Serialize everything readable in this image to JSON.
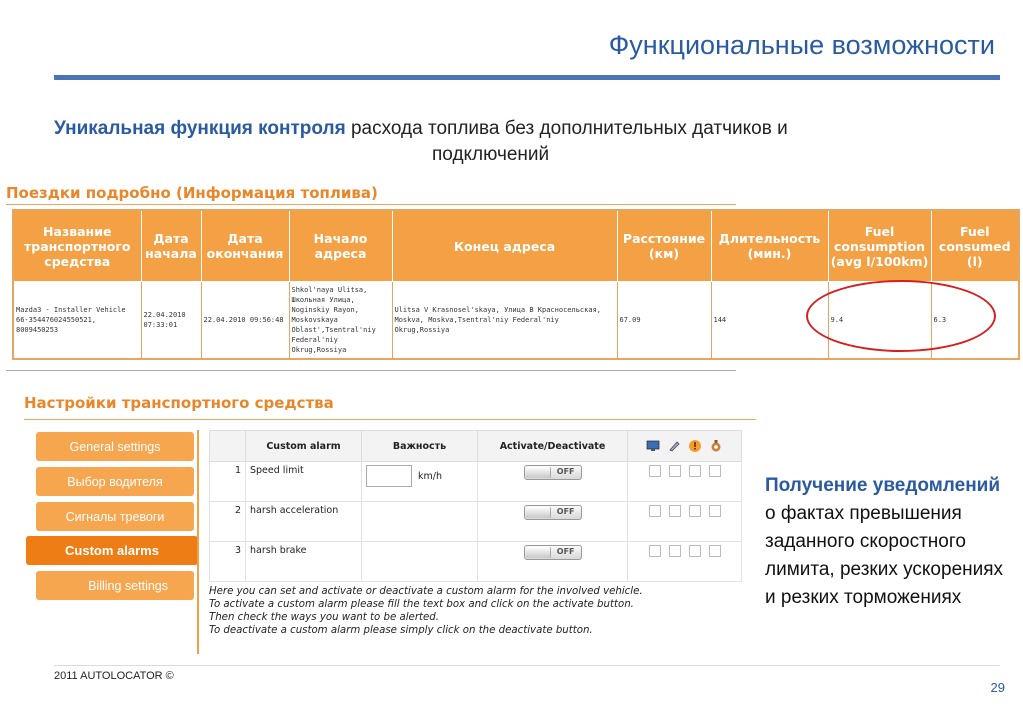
{
  "title": "Функциональные возможности",
  "subtitle": {
    "strong": "Уникальная функция контроля",
    "rest1": " расхода топлива без дополнительных датчиков и",
    "rest2": "подключений"
  },
  "fuel_section": {
    "heading": "Поездки подробно (Информация топлива)",
    "columns": [
      "Название транспортного средства",
      "Дата начала",
      "Дата окончания",
      "Начало адреса",
      "Конец адреса",
      "Расстояние (км)",
      "Длительность (мин.)",
      "Fuel consumption (avg l/100km)",
      "Fuel consumed (l)"
    ],
    "row": [
      "Mazda3 - Installer Vehicle 66-354476024550521, 8009450253",
      "22.04.2010 07:33:01",
      "22.04.2010 09:56:48",
      "Shkol'naya Ulitsa, Школьная Улица, Noginskiy Rayon, Moskovskaya Oblast',Tsentral'niy Federal'niy Okrug,Rossiya",
      "Ulitsa V Krasnosel'skaya, Улица В Красносельская, Moskva, Moskva,Tsentral'niy Federal'niy Okrug,Rossiya",
      "67.09",
      "144",
      "9.4",
      "6.3"
    ]
  },
  "vehicle_section": {
    "heading": "Настройки транспортного средства",
    "sidebar": [
      "General settings",
      "Выбор водителя",
      "Сигналы тревоги",
      "Custom alarms",
      "Billing settings"
    ],
    "table_headers": [
      "",
      "Custom alarm",
      "Важность",
      "Activate/Deactivate"
    ],
    "header_icons": [
      "monitor-icon",
      "pen-icon",
      "alert-icon",
      "settings-icon"
    ],
    "alarms": [
      {
        "num": "1",
        "name": "Speed limit",
        "unit": "km/h",
        "state": "OFF"
      },
      {
        "num": "2",
        "name": "harsh acceleration",
        "unit": "",
        "state": "OFF"
      },
      {
        "num": "3",
        "name": "harsh brake",
        "unit": "",
        "state": "OFF"
      }
    ],
    "note": [
      "Here you can set and activate or deactivate a custom alarm for the involved vehicle.",
      "To activate a custom alarm please fill the text box and click on the activate button.",
      "Then check the ways you want to be alerted.",
      "To deactivate a custom alarm please simply click on the deactivate button."
    ]
  },
  "notification": {
    "strong": "Получение уведомлений",
    "rest": " о фактах превышения заданного скоростного лимита, резких ускорениях и резких торможениях"
  },
  "footer": "2011 AUTOLOCATOR ©",
  "page_number": "29",
  "colors": {
    "accent_blue": "#2a5aa0",
    "orange": "#f4a044",
    "alert_red": "#d42020"
  }
}
